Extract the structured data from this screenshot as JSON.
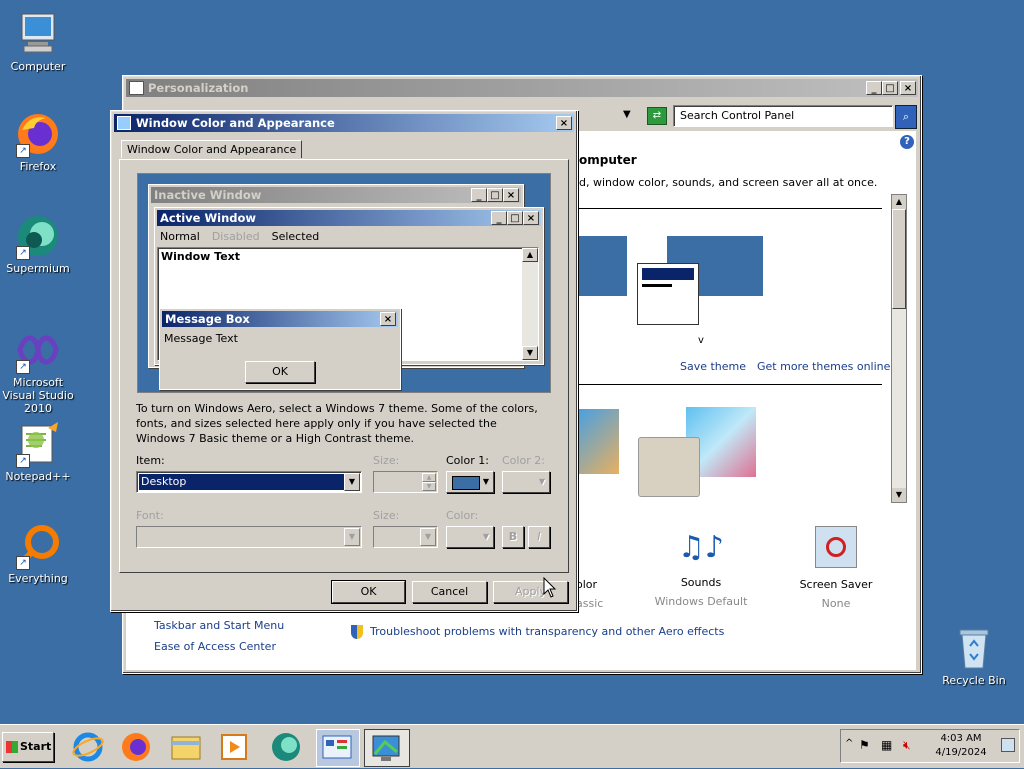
{
  "desktop": {
    "icons": [
      {
        "label": "Computer",
        "icon": "computer-icon"
      },
      {
        "label": "Firefox",
        "icon": "firefox-icon"
      },
      {
        "label": "Supermium",
        "icon": "supermium-icon"
      },
      {
        "label": "Microsoft Visual Studio 2010",
        "icon": "visual-studio-icon"
      },
      {
        "label": "Notepad++",
        "icon": "notepadpp-icon"
      },
      {
        "label": "Everything",
        "icon": "everything-icon"
      },
      {
        "label": "Recycle Bin",
        "icon": "recycle-bin-icon"
      }
    ]
  },
  "personalization": {
    "title": "Personalization",
    "search_placeholder": "Search Control Panel",
    "heading_partial": "omputer",
    "subtitle_partial": "d, window color, sounds, and screen saver all at once.",
    "save_theme": "Save theme",
    "get_more_themes": "Get more themes online",
    "theme_caption": "v",
    "bottom_items": [
      {
        "label": "olor",
        "sub": "assic"
      },
      {
        "label": "Sounds",
        "sub": "Windows Default"
      },
      {
        "label": "Screen Saver",
        "sub": "None"
      }
    ],
    "see_also": [
      "Taskbar and Start Menu",
      "Ease of Access Center"
    ],
    "troubleshoot": "Troubleshoot problems with transparency and other Aero effects"
  },
  "dialog": {
    "title": "Window Color and Appearance",
    "tab": "Window Color and Appearance",
    "preview": {
      "inactive_title": "Inactive Window",
      "active_title": "Active Window",
      "menu": [
        "Normal",
        "Disabled",
        "Selected"
      ],
      "window_text": "Window Text",
      "msgbox_title": "Message Box",
      "msgbox_text": "Message Text",
      "msgbox_ok": "OK"
    },
    "info_text": "To turn on Windows Aero, select a Windows 7 theme.  Some of the colors, fonts, and sizes selected here apply only if you have selected the Windows 7 Basic theme or a High Contrast theme.",
    "item_label": "Item:",
    "item_value": "Desktop",
    "size_label": "Size:",
    "color1_label": "Color 1:",
    "color2_label": "Color 2:",
    "font_label": "Font:",
    "font_size_label": "Size:",
    "font_color_label": "Color:",
    "bold_label": "B",
    "italic_label": "I",
    "color1_value": "#3a6ea5",
    "ok": "OK",
    "cancel": "Cancel",
    "apply": "Apply"
  },
  "taskbar": {
    "start": "Start",
    "time": "4:03 AM",
    "date": "4/19/2024",
    "pinned": [
      "internet-explorer-icon",
      "firefox-icon",
      "explorer-folder-icon",
      "media-player-icon",
      "supermium-icon",
      "control-panel-icon",
      "display-settings-icon"
    ]
  }
}
